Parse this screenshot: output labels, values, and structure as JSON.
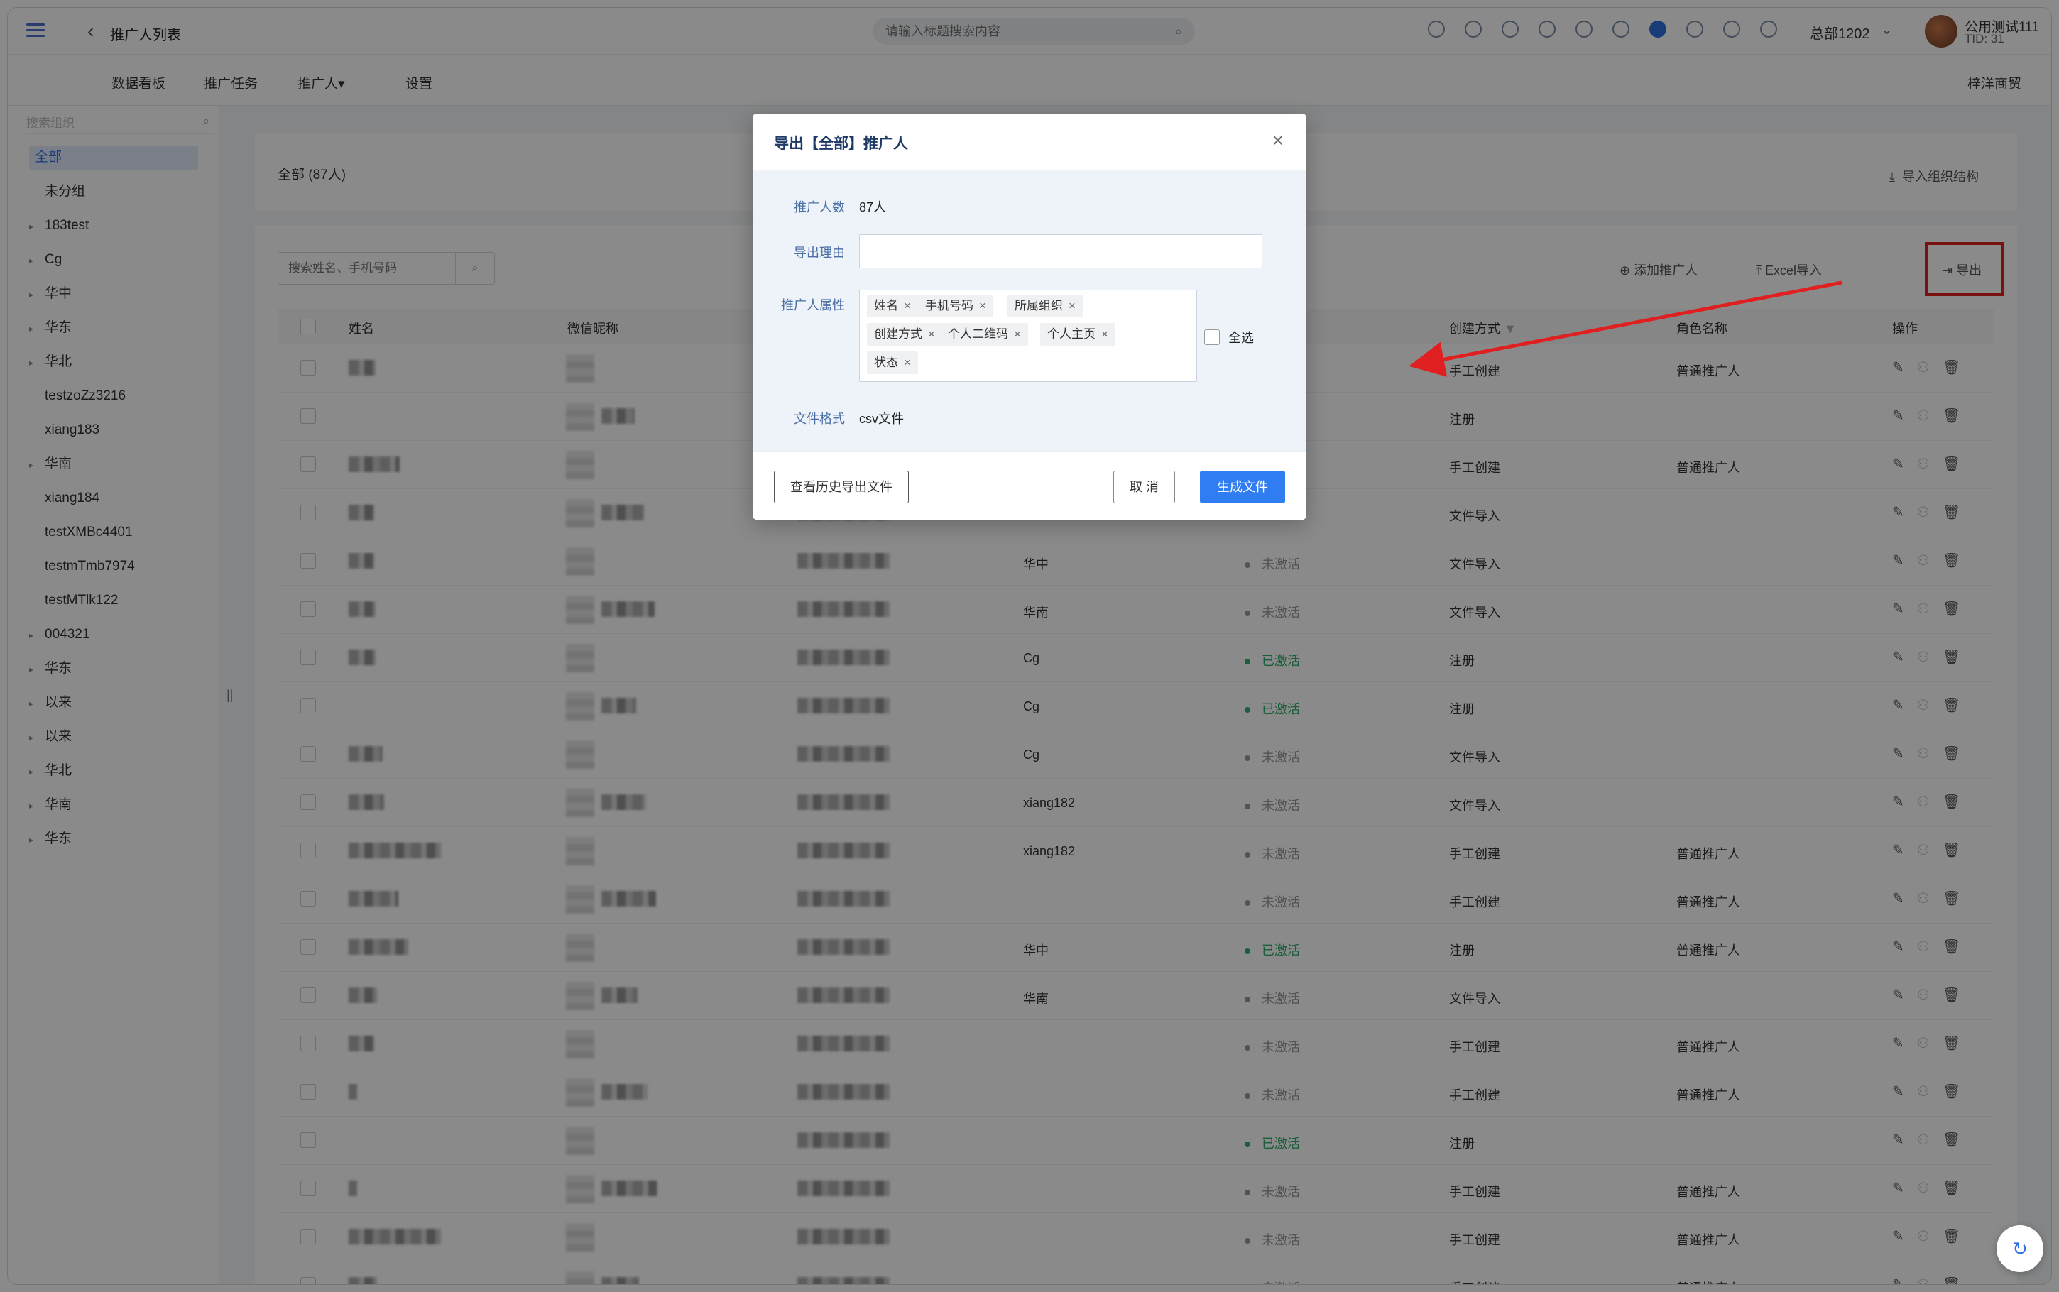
{
  "header": {
    "page_title": "推广人列表",
    "search_placeholder": "请输入标题搜索内容",
    "org": "总部1202",
    "user_name": "公用测试111",
    "user_tid": "TID: 31"
  },
  "nav": {
    "items": [
      "数据看板",
      "推广任务",
      "推广人▾",
      "设置"
    ],
    "company": "梓洋商贸"
  },
  "sidebar": {
    "search_placeholder": "搜索组织",
    "items": [
      {
        "label": "全部",
        "expandable": false,
        "active": true
      },
      {
        "label": "未分组",
        "expandable": false
      },
      {
        "label": "183test",
        "expandable": true
      },
      {
        "label": "Cg",
        "expandable": true
      },
      {
        "label": "华中",
        "expandable": true
      },
      {
        "label": "华东",
        "expandable": true
      },
      {
        "label": "华北",
        "expandable": true
      },
      {
        "label": "testzoZz3216",
        "expandable": false
      },
      {
        "label": "xiang183",
        "expandable": false
      },
      {
        "label": "华南",
        "expandable": true
      },
      {
        "label": "xiang184",
        "expandable": false
      },
      {
        "label": "testXMBc4401",
        "expandable": false
      },
      {
        "label": "testmTmb7974",
        "expandable": false
      },
      {
        "label": "testMTlk122",
        "expandable": false
      },
      {
        "label": "004321",
        "expandable": true
      },
      {
        "label": "华东",
        "expandable": true
      },
      {
        "label": "以来",
        "expandable": true
      },
      {
        "label": "以来",
        "expandable": true
      },
      {
        "label": "华北",
        "expandable": true
      },
      {
        "label": "华南",
        "expandable": true
      },
      {
        "label": "华东",
        "expandable": true
      }
    ]
  },
  "summary": {
    "all_label": "全部 (87人)",
    "import_structure": "导入组织结构"
  },
  "list": {
    "search_placeholder": "搜索姓名、手机号码",
    "add_label": "添加推广人",
    "excel_label": "Excel导入",
    "export_label": "导出",
    "columns": [
      "姓名",
      "微信昵称",
      "创建方式",
      "角色名称",
      "操作"
    ],
    "rows": [
      {
        "org": "",
        "status": "",
        "create": "手工创建",
        "role": "普通推广人"
      },
      {
        "org": "",
        "status": "",
        "create": "注册",
        "role": ""
      },
      {
        "org": "",
        "status": "",
        "create": "手工创建",
        "role": "普通推广人"
      },
      {
        "org": "",
        "status": "",
        "create": "文件导入",
        "role": ""
      },
      {
        "org": "华中",
        "status": "未激活",
        "create": "文件导入",
        "role": ""
      },
      {
        "org": "华南",
        "status": "未激活",
        "create": "文件导入",
        "role": ""
      },
      {
        "org": "Cg",
        "status": "已激活",
        "create": "注册",
        "role": ""
      },
      {
        "org": "Cg",
        "status": "已激活",
        "create": "注册",
        "role": ""
      },
      {
        "org": "Cg",
        "status": "未激活",
        "create": "文件导入",
        "role": ""
      },
      {
        "org": "xiang182",
        "status": "未激活",
        "create": "文件导入",
        "role": ""
      },
      {
        "org": "xiang182",
        "status": "未激活",
        "create": "手工创建",
        "role": "普通推广人"
      },
      {
        "org": "",
        "status": "未激活",
        "create": "手工创建",
        "role": "普通推广人"
      },
      {
        "org": "华中",
        "status": "已激活",
        "create": "注册",
        "role": "普通推广人"
      },
      {
        "org": "华南",
        "status": "未激活",
        "create": "文件导入",
        "role": ""
      },
      {
        "org": "",
        "status": "未激活",
        "create": "手工创建",
        "role": "普通推广人"
      },
      {
        "org": "",
        "status": "未激活",
        "create": "手工创建",
        "role": "普通推广人"
      },
      {
        "org": "",
        "status": "已激活",
        "create": "注册",
        "role": ""
      },
      {
        "org": "",
        "status": "未激活",
        "create": "手工创建",
        "role": "普通推广人"
      },
      {
        "org": "",
        "status": "未激活",
        "create": "手工创建",
        "role": "普通推广人"
      },
      {
        "org": "",
        "status": "未激活",
        "create": "手工创建",
        "role": "普通推广人"
      }
    ]
  },
  "modal": {
    "title": "导出【全部】推广人",
    "count_label": "推广人数",
    "count_value": "87人",
    "reason_label": "导出理由",
    "reason_value": "",
    "attrs_label": "推广人属性",
    "attrs": [
      "姓名",
      "手机号码",
      "所属组织",
      "创建方式",
      "个人二维码",
      "个人主页",
      "状态"
    ],
    "select_all": "全选",
    "format_label": "文件格式",
    "format_value": "csv文件",
    "history_button": "查看历史导出文件",
    "cancel_button": "取 消",
    "generate_button": "生成文件"
  },
  "colors": {
    "accent": "#2f7df0",
    "annotation": "#e02020",
    "active_status": "#2faf6b"
  }
}
